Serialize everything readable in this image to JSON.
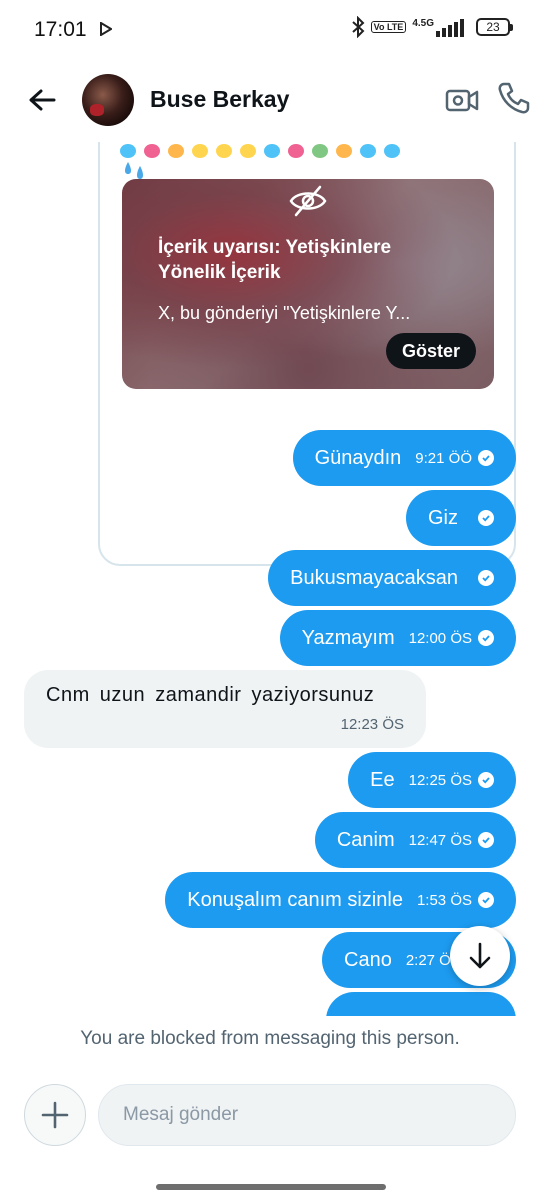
{
  "status_bar": {
    "time": "17:01",
    "network": "4.5G",
    "volte": "Vo LTE",
    "battery": "23"
  },
  "header": {
    "contact_name": "Buse Berkay",
    "icons": [
      "back-arrow-icon",
      "video-camera-icon",
      "phone-icon"
    ]
  },
  "media_card": {
    "warning_title": "İçerik uyarısı: Yetişkinlere Yönelik İçerik",
    "warning_desc": "X, bu gönderiyi \"Yetişkinlere Y...",
    "show_label": "Göster"
  },
  "messages": [
    {
      "text": "Günaydın",
      "time": "9:21 ÖÖ",
      "direction": "out"
    },
    {
      "text": "Giz",
      "time": "",
      "direction": "out"
    },
    {
      "text": "Bukusmayacaksan",
      "time": "",
      "direction": "out"
    },
    {
      "text": "Yazmayım",
      "time": "12:00 ÖS",
      "direction": "out"
    },
    {
      "text": "Cnm uzun zamandir yaziyorsunuz",
      "time": "12:23 ÖS",
      "direction": "in"
    },
    {
      "text": "Ee",
      "time": "12:25 ÖS",
      "direction": "out"
    },
    {
      "text": "Canim",
      "time": "12:47 ÖS",
      "direction": "out"
    },
    {
      "text": "Konuşalım canım sizinle",
      "time": "1:53 ÖS",
      "direction": "out"
    },
    {
      "text": "Cano",
      "time": "2:27 Ö",
      "direction": "out"
    }
  ],
  "blocked_note": "You are blocked from messaging this person.",
  "composer": {
    "placeholder": "Mesaj gönder"
  },
  "colors": {
    "accent": "#1d9bf0",
    "incoming_bubble": "#eff3f4",
    "text": "#0f1419",
    "muted": "#536471"
  }
}
